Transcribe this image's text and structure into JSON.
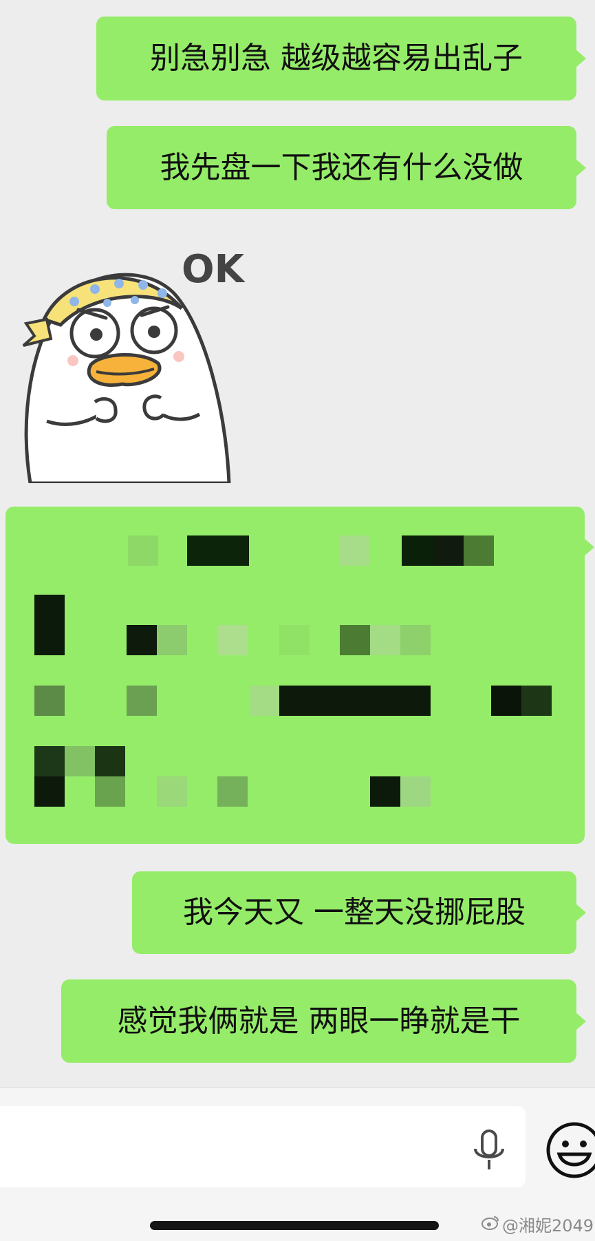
{
  "messages": [
    {
      "text": "别急别急 越级越容易出乱子"
    },
    {
      "text": "我先盘一下我还有什么没做"
    },
    {
      "sticker": {
        "caption": "OK",
        "icon": "duck-ok-sticker"
      }
    },
    {
      "redacted": true
    },
    {
      "text": "我今天又 一整天没挪屁股"
    },
    {
      "text": "感觉我俩就是 两眼一睁就是干"
    }
  ],
  "input_bar": {
    "mic_icon": "microphone-icon",
    "emoji_icon": "emoji-smile-icon"
  },
  "watermark": {
    "text": "@湘妮2049",
    "icon": "weibo-icon"
  },
  "colors": {
    "bubble_green": "#95ec69",
    "background": "#ededed"
  }
}
